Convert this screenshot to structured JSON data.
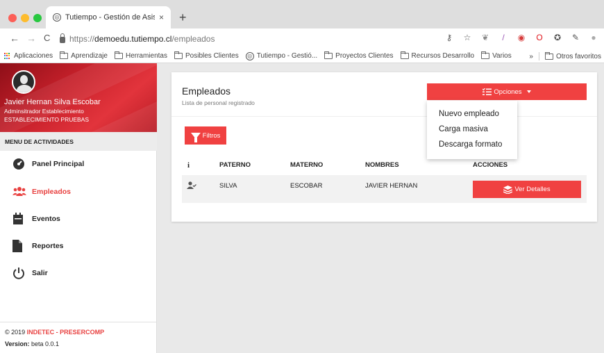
{
  "browser": {
    "tab_title": "Tutiempo - Gestión de Asisten",
    "tab_close": "×",
    "new_tab": "+",
    "url_proto": "https://",
    "url_host": "demoedu.tutiempo.cl",
    "url_path": "/empleados",
    "nav_back": "←",
    "nav_forward": "→",
    "nav_reload": "C",
    "bookmarks": [
      "Aplicaciones",
      "Aprendizaje",
      "Herramientas",
      "Posibles Clientes",
      "Tutiempo - Gestió...",
      "Proyectos Clientes",
      "Recursos Desarrollo",
      "Varios"
    ],
    "bookmarks_more": "»",
    "bookmarks_other": "Otros favoritos",
    "colors": {
      "chrome_bg": "#dedede",
      "close": "#fc5f57",
      "minimize": "#fdbc2e",
      "maximize": "#28c840"
    }
  },
  "sidebar": {
    "user_name": "Javier Hernan Silva Escobar",
    "user_role": "Adminsitrador Establecimiento",
    "establishment": "ESTABLECIMIENTO PRUEBAS",
    "menu_header": "MENU DE ACTIVIDADES",
    "items": [
      {
        "label": "Panel Principal",
        "icon": "dashboard-icon",
        "active": false
      },
      {
        "label": "Empleados",
        "icon": "users-icon",
        "active": true
      },
      {
        "label": "Eventos",
        "icon": "calendar-icon",
        "active": false
      },
      {
        "label": "Reportes",
        "icon": "document-icon",
        "active": false
      },
      {
        "label": "Salir",
        "icon": "power-icon",
        "active": false
      }
    ],
    "footer_copy": "© 2019",
    "footer_brand": "INDETEC - PRESERCOMP",
    "version_label": "Version:",
    "version_value": "beta 0.0.1"
  },
  "main": {
    "title": "Empleados",
    "subtitle": "Lista de personal registrado",
    "options_button": "Opciones",
    "filters_button": "Filtros",
    "table": {
      "columns": [
        "i",
        "PATERNO",
        "MATERNO",
        "NOMBRES",
        "ACCIONES"
      ],
      "rows": [
        {
          "paterno": "SILVA",
          "materno": "ESCOBAR",
          "nombres": "JAVIER HERNAN",
          "action": "Ver Detalles"
        }
      ]
    },
    "dropdown": [
      "Nuevo empleado",
      "Carga masiva",
      "Descarga formato"
    ]
  },
  "colors": {
    "accent": "#f04141",
    "active_menu": "#e8403f",
    "profile_bg": "#c8212b"
  }
}
